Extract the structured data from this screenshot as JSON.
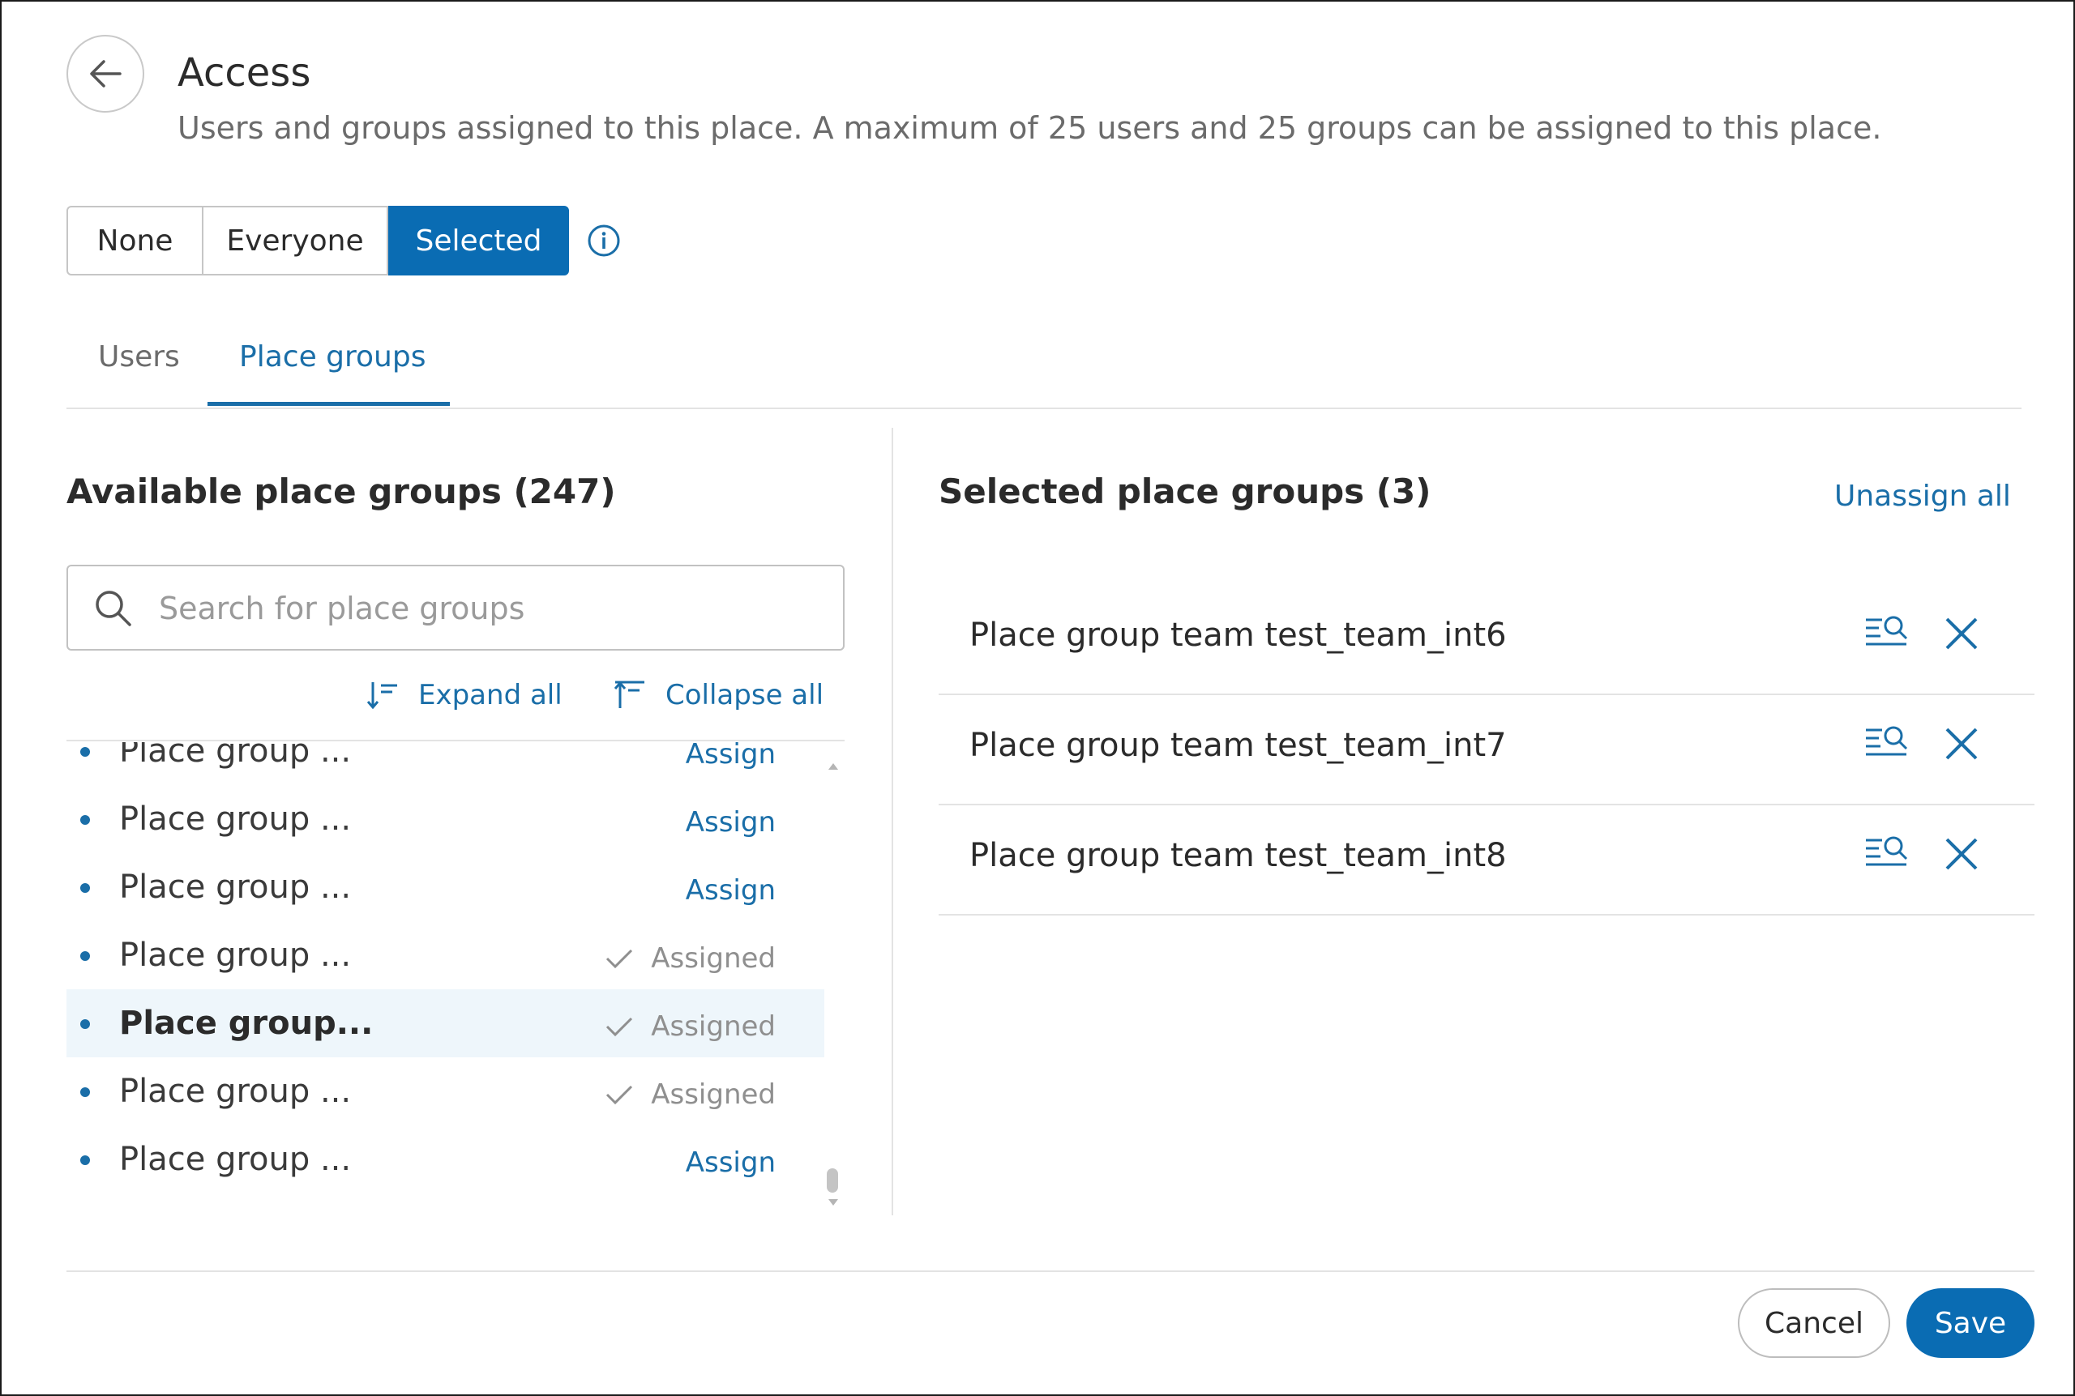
{
  "header": {
    "title": "Access",
    "subtitle": "Users and groups assigned to this place. A maximum of 25 users and 25 groups can be assigned to this place.",
    "back_icon": "arrow-left-icon"
  },
  "access_mode": {
    "options": [
      "None",
      "Everyone",
      "Selected"
    ],
    "selected": "Selected",
    "info_icon": "info-icon"
  },
  "tabs": {
    "items": [
      "Users",
      "Place groups"
    ],
    "active": "Place groups"
  },
  "available": {
    "heading": "Available place groups (247)",
    "search_placeholder": "Search for place groups",
    "search_value": "",
    "expand_all": "Expand all",
    "collapse_all": "Collapse all",
    "rows": [
      {
        "name": "Place group ...",
        "status": "Assign",
        "highlighted": false
      },
      {
        "name": "Place group ...",
        "status": "Assign",
        "highlighted": false
      },
      {
        "name": "Place group ...",
        "status": "Assign",
        "highlighted": false
      },
      {
        "name": "Place group ...",
        "status": "Assigned",
        "highlighted": false
      },
      {
        "name": "Place group...",
        "status": "Assigned",
        "highlighted": true
      },
      {
        "name": "Place group ...",
        "status": "Assigned",
        "highlighted": false
      },
      {
        "name": "Place group ...",
        "status": "Assign",
        "highlighted": false
      }
    ]
  },
  "selected": {
    "heading": "Selected place groups (3)",
    "unassign_all": "Unassign all",
    "items": [
      "Place group team test_team_int6",
      "Place group team test_team_int7",
      "Place group team test_team_int8"
    ]
  },
  "footer": {
    "cancel": "Cancel",
    "save": "Save"
  },
  "colors": {
    "accent": "#0a6cb3",
    "link": "#1a6ea8",
    "row_highlight": "#eef6fb"
  }
}
